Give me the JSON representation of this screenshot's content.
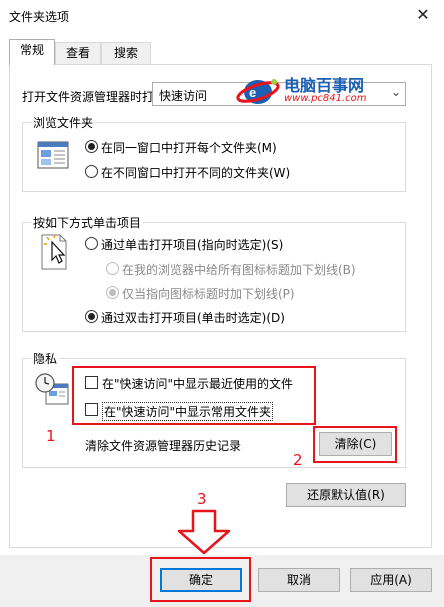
{
  "window": {
    "title": "文件夹选项",
    "close_glyph": "✕"
  },
  "tabs": [
    {
      "label": "常规",
      "active": true
    },
    {
      "label": "查看"
    },
    {
      "label": "搜索"
    }
  ],
  "open_explorer": {
    "label": "打开文件资源管理器时打",
    "selected": "快速访问",
    "arrow": "⌄"
  },
  "watermark": {
    "site": "电脑百事网",
    "url": "www.pc841.com",
    "brand_colors": [
      "#e8141b",
      "#1a5fb4",
      "#9cd14c"
    ]
  },
  "browse_folders": {
    "title": "浏览文件夹",
    "icon": "window-icon",
    "options": [
      {
        "label": "在同一窗口中打开每个文件夹(M)",
        "checked": true
      },
      {
        "label": "在不同窗口中打开不同的文件夹(W)",
        "checked": false
      }
    ]
  },
  "click_items": {
    "title": "按如下方式单击项目",
    "icon": "pointer-click-icon",
    "single_click": {
      "label": "通过单击打开项目(指向时选定)(S)",
      "checked": false
    },
    "sub_options": [
      {
        "label": "在我的浏览器中给所有图标标题加下划线(B)",
        "checked": false
      },
      {
        "label": "仅当指向图标标题时加下划线(P)",
        "checked": true
      }
    ],
    "double_click": {
      "label": "通过双击打开项目(单击时选定)(D)",
      "checked": true
    }
  },
  "privacy": {
    "title": "隐私",
    "icon": "privacy-clock-icon",
    "checkboxes": [
      {
        "label": "在\"快速访问\"中显示最近使用的文件",
        "checked": false
      },
      {
        "label": "在\"快速访问\"中显示常用文件夹",
        "checked": false
      }
    ],
    "clear_history_label": "清除文件资源管理器历史记录",
    "clear_button": "清除(C)"
  },
  "restore_defaults": "还原默认值(R)",
  "annotations": {
    "one": "1",
    "two": "2",
    "three": "3",
    "arrow": "down-arrow-icon",
    "color": "#e8141b"
  },
  "footer": {
    "ok": "确定",
    "cancel": "取消",
    "apply": "应用(A)"
  }
}
